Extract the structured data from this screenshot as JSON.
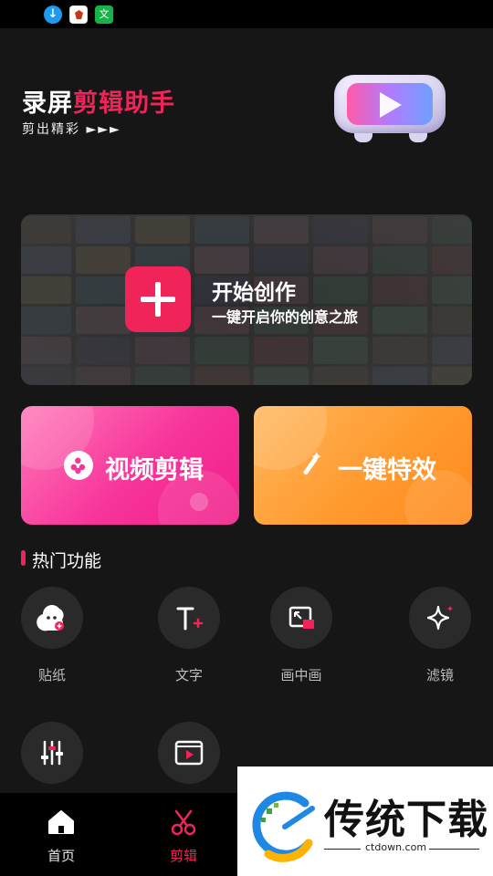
{
  "status_bar": {
    "icons": [
      "download-notification-icon",
      "app-notification-icon",
      "green-app-notification-icon"
    ]
  },
  "header": {
    "title_part1": "录屏",
    "title_part2": "剪辑助手",
    "subtitle": "剪出精彩 ►►►",
    "mascot_icon": "tv-play-icon"
  },
  "hero": {
    "title": "开始创作",
    "subtitle": "一键开启你的创意之旅",
    "accent": "#f1245a"
  },
  "cards": {
    "video_edit": "视频剪辑",
    "effects": "一键特效"
  },
  "hot_features": {
    "title": "热门功能",
    "items": [
      {
        "label": "贴纸",
        "icon": "sticker-icon"
      },
      {
        "label": "文字",
        "icon": "text-icon"
      },
      {
        "label": "画中画",
        "icon": "picture-in-picture-icon"
      },
      {
        "label": "滤镜",
        "icon": "sparkle-filter-icon"
      },
      {
        "label": "",
        "icon": "adjust-sliders-icon"
      },
      {
        "label": "",
        "icon": "video-frame-icon"
      }
    ]
  },
  "bottom_nav": {
    "home": "首页",
    "edit": "剪辑",
    "active": "edit"
  },
  "watermark": {
    "name": "传统下载",
    "url": "ctdown.com"
  },
  "colors": {
    "accent": "#f1245a",
    "background": "#161616",
    "pink_card": "#f7349a",
    "orange_card": "#ff9a2e"
  }
}
